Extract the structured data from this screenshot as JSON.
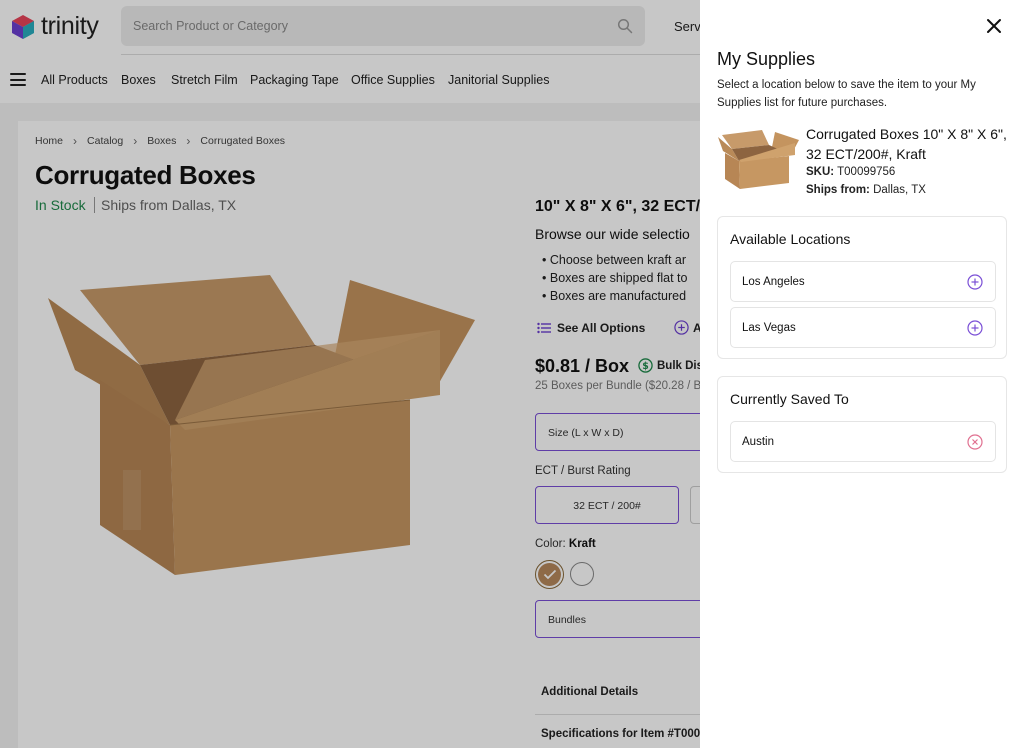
{
  "header": {
    "brand": "trinity",
    "search_placeholder": "Search Product or Category",
    "services_label": "Servi"
  },
  "nav": {
    "items": [
      "All Products",
      "Boxes",
      "Stretch Film",
      "Packaging Tape",
      "Office Supplies",
      "Janitorial Supplies"
    ]
  },
  "breadcrumb": [
    "Home",
    "Catalog",
    "Boxes",
    "Corrugated Boxes"
  ],
  "product": {
    "title": "Corrugated Boxes",
    "stock": "In Stock",
    "ships_from": "Ships from Dallas, TX",
    "subheading": "10\" X 8\" X 6\", 32 ECT/",
    "browse": "Browse our wide selectio",
    "bullets": [
      "Choose between kraft ar",
      "Boxes are shipped flat to",
      "Boxes are manufactured"
    ],
    "see_all_options": "See All Options",
    "add_label": "A",
    "price": "$0.81 / Box",
    "bulk_label": "Bulk Disc",
    "per_bundle": "25 Boxes per Bundle ($20.28 / B",
    "size_label": "Size (L x W x D)",
    "ect_label": "ECT / Burst Rating",
    "ect_value": "32 ECT / 200#",
    "color_prefix": "Color:",
    "color_value": "Kraft",
    "bundles_label": "Bundles",
    "additional_details": "Additional Details",
    "specifications": "Specifications for Item #T000"
  },
  "drawer": {
    "title": "My Supplies",
    "description": "Select a location below to save the item to your My Supplies list for future purchases.",
    "item_name": "Corrugated Boxes 10\" X 8\" X 6\", 32 ECT/200#, Kraft",
    "sku_label": "SKU:",
    "sku_value": "T00099756",
    "ships_label": "Ships from:",
    "ships_value": "Dallas, TX",
    "available_title": "Available Locations",
    "available_locations": [
      "Los Angeles",
      "Las Vegas"
    ],
    "saved_title": "Currently Saved To",
    "saved_locations": [
      "Austin"
    ]
  },
  "colors": {
    "accent": "#7a4fd6",
    "stock_green": "#1f8a4c",
    "remove_red": "#e07090",
    "kraft": "#b7885b"
  }
}
